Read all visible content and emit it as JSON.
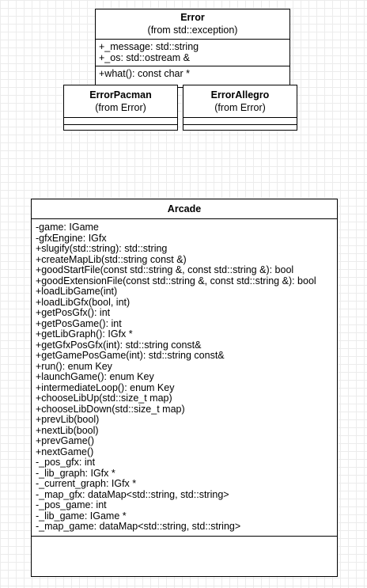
{
  "classes": {
    "error": {
      "name": "Error",
      "stereotype": "(from std::exception)",
      "attributes": [
        "+_message: std::string",
        "+_os: std::ostream &"
      ],
      "operations": [
        "+what(): const char *"
      ]
    },
    "error_pacman": {
      "name": "ErrorPacman",
      "stereotype": "(from Error)"
    },
    "error_allegro": {
      "name": "ErrorAllegro",
      "stereotype": "(from Error)"
    },
    "arcade": {
      "name": "Arcade",
      "members": [
        "-game: IGame",
        "-gfxEngine: IGfx",
        "+slugify(std::string): std::string",
        "+createMapLib(std::string const &)",
        "+goodStartFile(const std::string &, const std::string &): bool",
        "+goodExtensionFile(const std::string &, const std::string &): bool",
        "+loadLibGame(int)",
        "+loadLibGfx(bool, int)",
        "+getPosGfx(): int",
        "+getPosGame(): int",
        "+getLibGraph(): IGfx *",
        "+getGfxPosGfx(int): std::string const&",
        "+getGamePosGame(int): std::string const&",
        "+run(): enum Key",
        "+launchGame(): enum Key",
        "+intermediateLoop(): enum Key",
        "+chooseLibUp(std::size_t map)",
        "+chooseLibDown(std::size_t map)",
        "+prevLib(bool)",
        "+nextLib(bool)",
        "+prevGame()",
        "+nextGame()",
        "-_pos_gfx: int",
        "-_lib_graph: IGfx *",
        "-_current_graph: IGfx *",
        "-_map_gfx: dataMap<std::string, std::string>",
        "-_pos_game: int",
        "-_lib_game: IGame *",
        "-_map_game: dataMap<std::string, std::string>"
      ]
    }
  }
}
